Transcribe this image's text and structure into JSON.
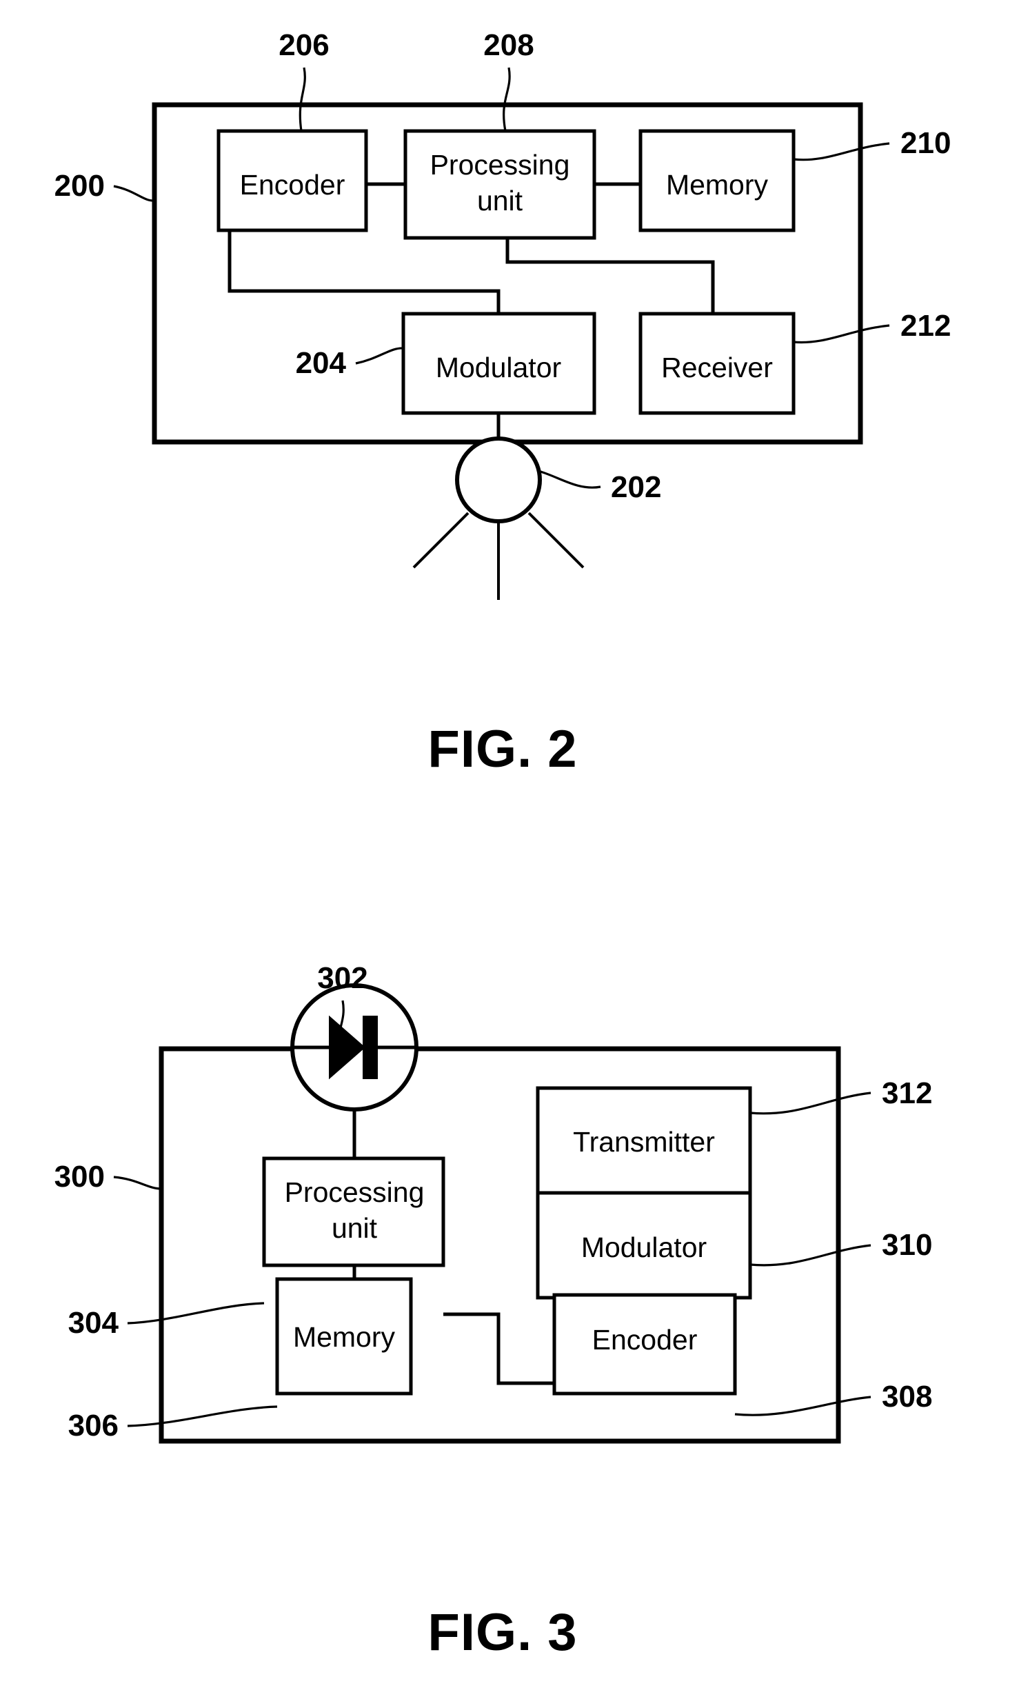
{
  "sheet": {
    "background_color": "#ffffff",
    "ink_color": "#000000"
  },
  "figures": [
    {
      "id": "fig-2",
      "caption": "FIG. 2",
      "device_reference": "200",
      "blocks": [
        {
          "key": "encoder",
          "label": "Encoder",
          "reference": "206"
        },
        {
          "key": "processing_unit",
          "label": "Processing unit",
          "reference": "208",
          "line1": "Processing",
          "line2": "unit"
        },
        {
          "key": "memory",
          "label": "Memory",
          "reference": "210"
        },
        {
          "key": "modulator",
          "label": "Modulator",
          "reference": "204"
        },
        {
          "key": "receiver",
          "label": "Receiver",
          "reference": "212"
        }
      ],
      "emitter": {
        "key": "light-source",
        "reference": "202",
        "icon": "light-emitter-circle-with-rays"
      }
    },
    {
      "id": "fig-3",
      "caption": "FIG. 3",
      "device_reference": "300",
      "blocks": [
        {
          "key": "processing_unit",
          "label": "Processing unit",
          "reference": "304",
          "line1": "Processing",
          "line2": "unit"
        },
        {
          "key": "memory",
          "label": "Memory",
          "reference": "306"
        },
        {
          "key": "transmitter",
          "label": "Transmitter",
          "reference": "312"
        },
        {
          "key": "modulator",
          "label": "Modulator",
          "reference": "310"
        },
        {
          "key": "encoder",
          "label": "Encoder",
          "reference": "308"
        }
      ],
      "detector": {
        "key": "photodiode",
        "reference": "302",
        "icon": "photodiode-circle-symbol"
      }
    }
  ]
}
